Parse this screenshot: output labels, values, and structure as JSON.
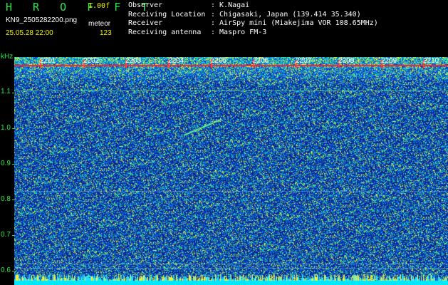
{
  "header": {
    "title": "H R O F F T",
    "version": "1.00f",
    "filename": "KN9_2505282200.png",
    "mode": "meteor",
    "datetime": "25.05.28 22:00",
    "count": "123",
    "observer_label": "Observer",
    "observer_value": ": K.Nagai",
    "location_label": "Receiving Location",
    "location_value": ": Chigasaki, Japan (139.414 35.340)",
    "receiver_label": "Receiver",
    "receiver_value": ": AirSpy mini (Miakejima VOR 108.65MHz)",
    "antenna_label": "Receiving antenna",
    "antenna_value": ": Maspro FM-3"
  },
  "axis": {
    "unit": "kHz",
    "y_labels": [
      "1.1",
      "1.0",
      "0.9",
      "0.8",
      "0.7",
      "0.6"
    ],
    "x_labels": [
      "2201",
      "2202",
      "2203",
      "2204",
      "2205",
      "2206",
      "2207",
      "2208",
      "2209",
      "2210"
    ]
  },
  "colors": {
    "background": "#0a2a9a",
    "label_green": "#2ee84a",
    "label_yellow": "#f0f000",
    "marker_red": "#ff2020",
    "trace": "#40ff80"
  }
}
